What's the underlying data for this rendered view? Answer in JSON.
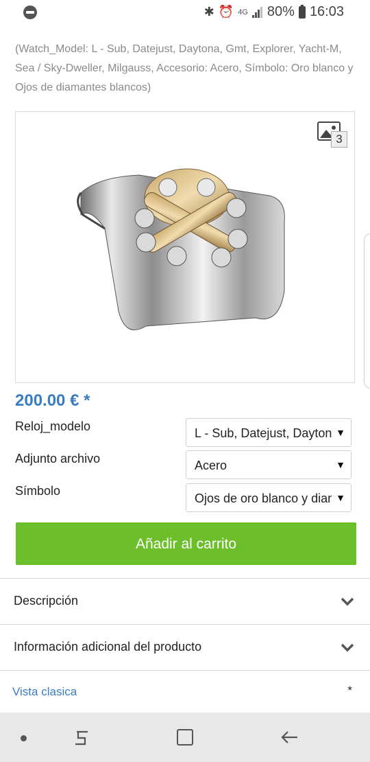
{
  "status": {
    "battery": "80%",
    "time": "16:03",
    "network": "4G"
  },
  "product": {
    "description": "(Watch_Model: L - Sub, Datejust, Daytona, Gmt, Explorer, Yacht-M, Sea / Sky-Dweller, Milgauss, Accesorio: Acero, Símbolo: Oro blanco y Ojos de diamantes blancos)",
    "image_count": "3",
    "price": "200.00 € *"
  },
  "options": [
    {
      "label": "Reloj_modelo",
      "value": "L - Sub, Datejust, Daytona, Gmt, Explorer"
    },
    {
      "label": "Adjunto archivo",
      "value": "Acero"
    },
    {
      "label": "Símbolo",
      "value": "Ojos de oro blanco y diamantes blancos"
    }
  ],
  "cart_button": "Añadir al carrito",
  "accordion": [
    {
      "label": "Descripción"
    },
    {
      "label": "Información adicional del producto"
    }
  ],
  "footer": {
    "classic_link": "Vista clasica",
    "asterisk": "*"
  },
  "colors": {
    "accent_blue": "#3a7cc0",
    "cart_green": "#6cbf2a"
  }
}
